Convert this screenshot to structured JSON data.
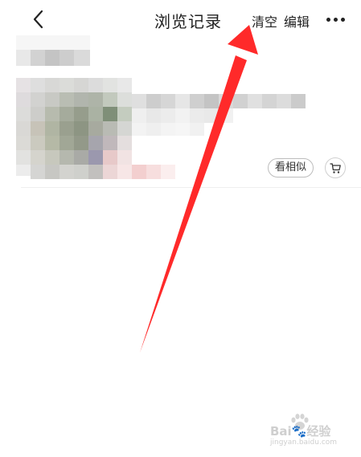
{
  "header": {
    "title": "浏览记录",
    "clear_label": "清空",
    "edit_label": "编辑",
    "back_icon": "chevron-left-icon",
    "more_icon": "more-dots-icon"
  },
  "item": {
    "similar_label": "看相似",
    "cart_icon": "cart-icon"
  },
  "annotation": {
    "arrow_color": "#ff2a2a",
    "arrow_target": "clear-button"
  },
  "watermark": {
    "brand_text": "Bai🐾经验",
    "url_text": "jingyan.baidu.com"
  }
}
